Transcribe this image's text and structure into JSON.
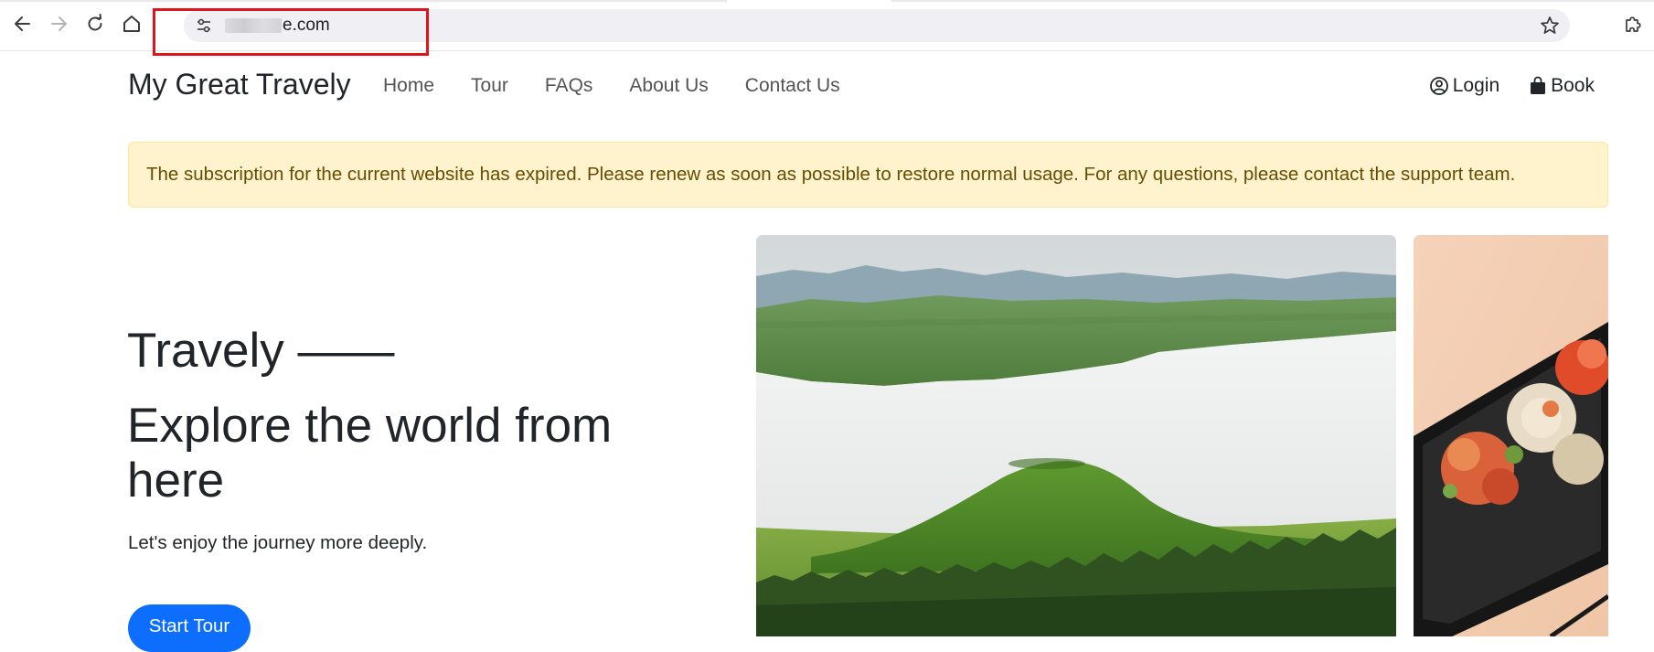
{
  "browser": {
    "url_visible_suffix": "e.com",
    "icons": [
      "back-arrow-icon",
      "forward-arrow-icon",
      "reload-icon",
      "home-icon",
      "site-settings-icon",
      "bookmark-star-icon",
      "extensions-puzzle-icon"
    ]
  },
  "navbar": {
    "brand": "My Great Travely",
    "links": [
      "Home",
      "Tour",
      "FAQs",
      "About Us",
      "Contact Us"
    ],
    "login_label": "Login",
    "book_label": "Book",
    "icons": [
      "user-circle-icon",
      "shopping-bag-icon"
    ]
  },
  "alert": {
    "message": "The subscription for the current website has expired. Please renew as soon as possible to restore normal usage. For any questions, please contact the support team."
  },
  "hero": {
    "title_line1": "Travely ——",
    "title_line2": "Explore the world from here",
    "subtitle": "Let's enjoy the journey more deeply.",
    "cta_label": "Start Tour"
  },
  "colors": {
    "primary": "#0d6efd",
    "alert_bg": "#fff3cd",
    "alert_text": "#664d03",
    "highlight_box": "#e0141b"
  }
}
